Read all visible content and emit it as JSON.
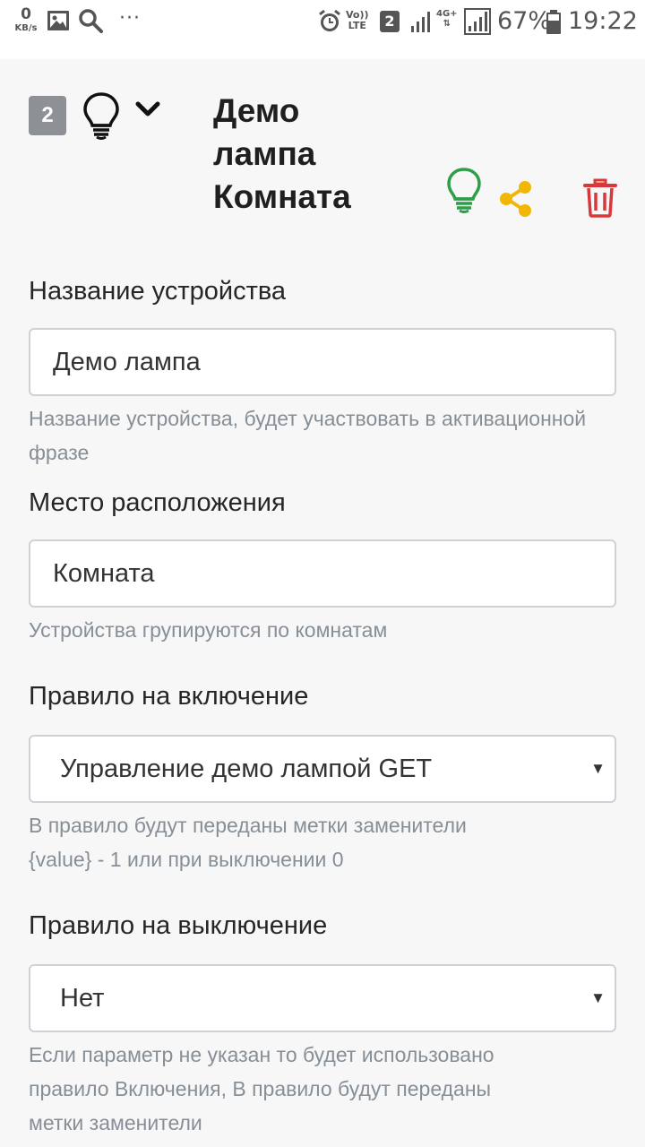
{
  "status_bar": {
    "net_speed_value": "0",
    "net_speed_unit": "KB/s",
    "more": "···",
    "volte_line1": "Vo))",
    "volte_line2": "LTE",
    "sim": "2",
    "network_line1": "4G+",
    "network_line2": "⇅",
    "battery": "67%",
    "time": "19:22"
  },
  "header": {
    "number": "2",
    "title_line1": "Демо",
    "title_line2": "лампа",
    "title_line3": "Комната"
  },
  "icons": {
    "bulb_main": "lightbulb-icon",
    "bulb_status": "lightbulb-icon",
    "share": "share-icon",
    "delete": "trash-icon",
    "status_color": "#2e9e48",
    "share_color": "#f2b705",
    "delete_color": "#d9383a"
  },
  "form": {
    "device_name": {
      "label": "Название устройства",
      "value": "Демо лампа",
      "hint": "Название устройства, будет участвовать в активационной фразе"
    },
    "location": {
      "label": "Место расположения",
      "value": "Комната",
      "hint": "Устройства групируются по комнатам"
    },
    "rule_on": {
      "label": "Правило на включение",
      "value": "Управление демо лампой GET",
      "hint_line1": "В правило будут переданы метки заменители",
      "hint_line2": "{value} - 1 или при выключении 0"
    },
    "rule_off": {
      "label": "Правило на выключение",
      "value": "Нет",
      "hint_line1": "Если параметр не указан то будет использовано",
      "hint_line2": "правило Включения, В правило будут переданы",
      "hint_line3": "метки заменители"
    }
  }
}
